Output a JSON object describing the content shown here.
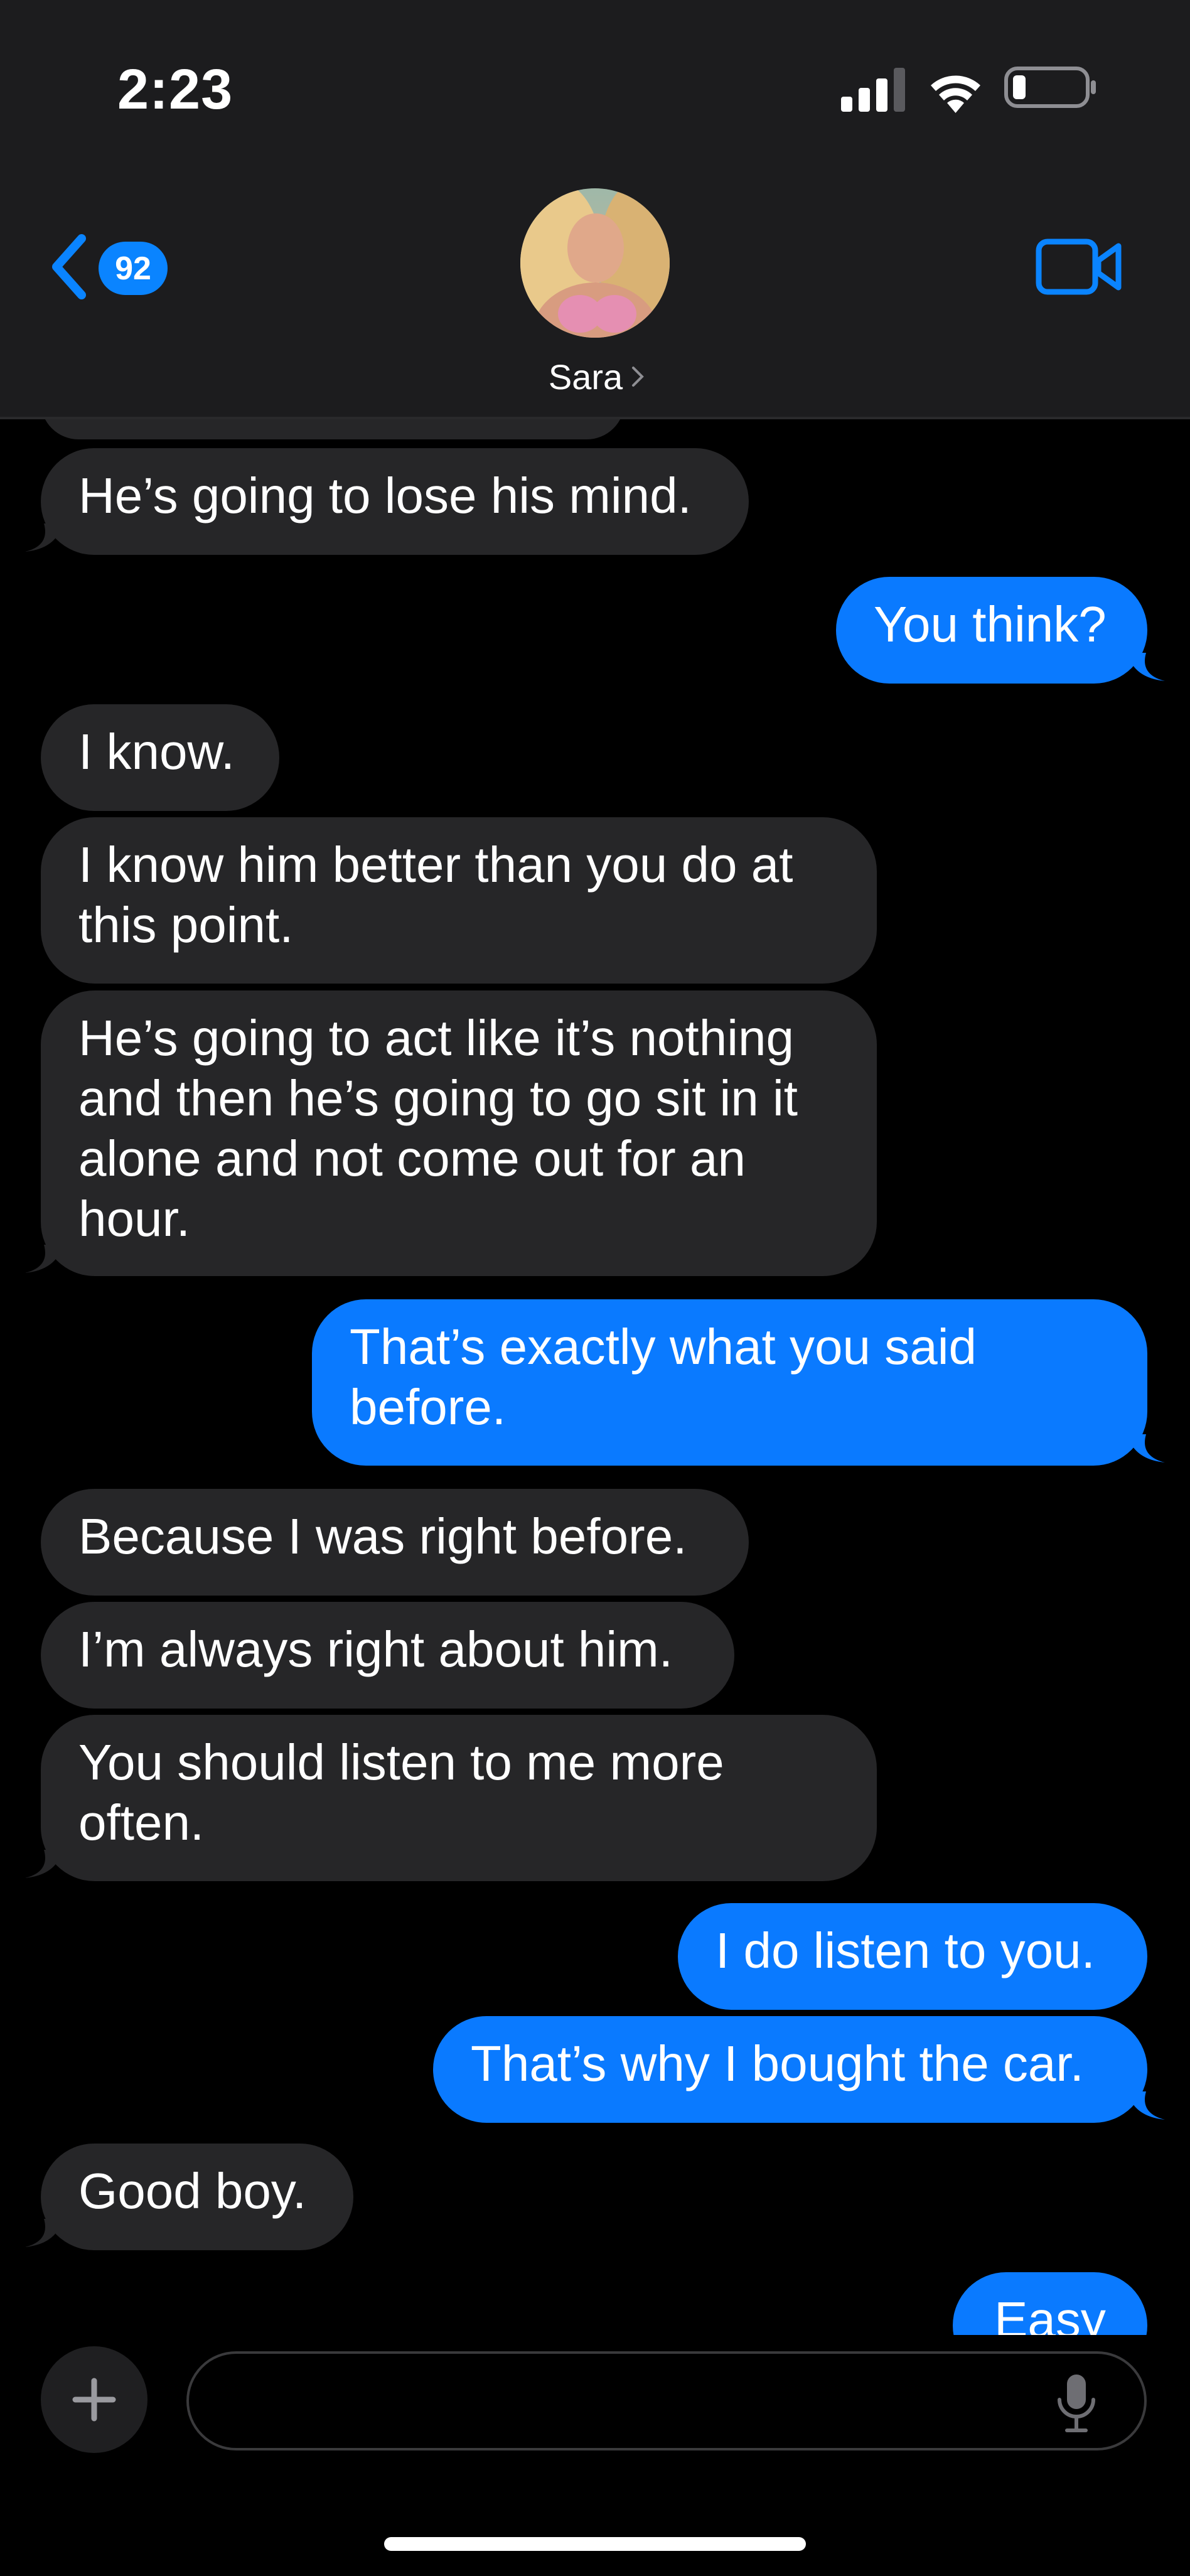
{
  "status_bar": {
    "time": "2:23"
  },
  "header": {
    "back_badge_count": "92",
    "contact_name": "Sara"
  },
  "messages": [
    {
      "from": "contact",
      "text": "He’s going to lose his mind."
    },
    {
      "from": "me",
      "text": "You think?"
    },
    {
      "from": "contact",
      "text": "I know."
    },
    {
      "from": "contact",
      "text": "I know him better than you do at this point."
    },
    {
      "from": "contact",
      "text": "He’s going to act like it’s nothing and then he’s going to go sit in it alone and not come out for an hour."
    },
    {
      "from": "me",
      "text": "That’s exactly what you said before."
    },
    {
      "from": "contact",
      "text": "Because I was right before."
    },
    {
      "from": "contact",
      "text": "I’m always right about him."
    },
    {
      "from": "contact",
      "text": "You should listen to me more often."
    },
    {
      "from": "me",
      "text": "I do listen to you."
    },
    {
      "from": "me",
      "text": "That’s why I bought the car."
    },
    {
      "from": "contact",
      "text": "Good boy."
    },
    {
      "from": "me",
      "text": "Easy"
    }
  ],
  "composer": {
    "placeholder": ""
  },
  "colors": {
    "sent_bubble": "#0a7aff",
    "received_bubble": "#262628",
    "header_bg": "#1c1c1e",
    "accent": "#0a84ff"
  },
  "icons": [
    "back-chevron-icon",
    "video-camera-icon",
    "signal-icon",
    "wifi-icon",
    "battery-icon",
    "plus-icon",
    "microphone-icon"
  ]
}
